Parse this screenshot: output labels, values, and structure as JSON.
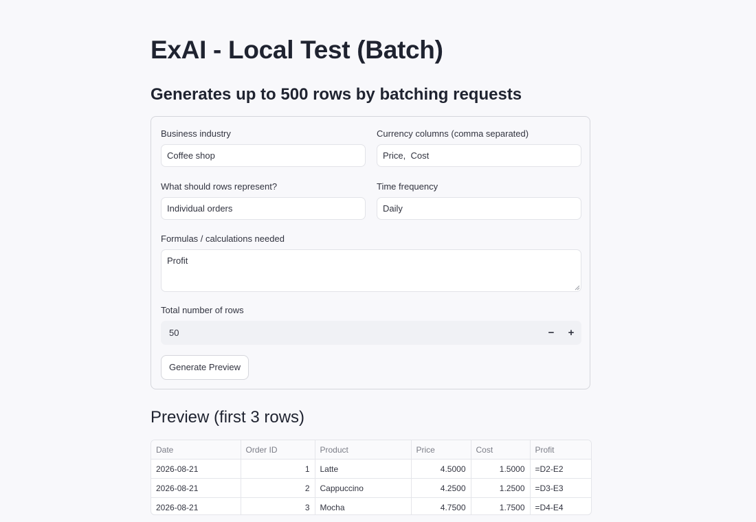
{
  "header": {
    "title": "ExAI - Local Test (Batch)",
    "subtitle": "Generates up to 500 rows by batching requests"
  },
  "form": {
    "industry": {
      "label": "Business industry",
      "value": "Coffee shop"
    },
    "currency": {
      "label": "Currency columns (comma separated)",
      "value": "Price,  Cost"
    },
    "rows_represent": {
      "label": "What should rows represent?",
      "value": "Individual orders"
    },
    "time_frequency": {
      "label": "Time frequency",
      "value": "Daily"
    },
    "formulas": {
      "label": "Formulas / calculations needed",
      "value": "Profit"
    },
    "total_rows": {
      "label": "Total number of rows",
      "value": "50",
      "decrement": "−",
      "increment": "+"
    },
    "generate_button": "Generate Preview"
  },
  "preview": {
    "title": "Preview (first 3 rows)",
    "columns": [
      "Date",
      "Order ID",
      "Product",
      "Price",
      "Cost",
      "Profit"
    ],
    "rows": [
      [
        "2026-08-21",
        "1",
        "Latte",
        "4.5000",
        "1.5000",
        "=D2-E2"
      ],
      [
        "2026-08-21",
        "2",
        "Cappuccino",
        "4.2500",
        "1.2500",
        "=D3-E3"
      ],
      [
        "2026-08-21",
        "3",
        "Mocha",
        "4.7500",
        "1.7500",
        "=D4-E4"
      ]
    ]
  }
}
